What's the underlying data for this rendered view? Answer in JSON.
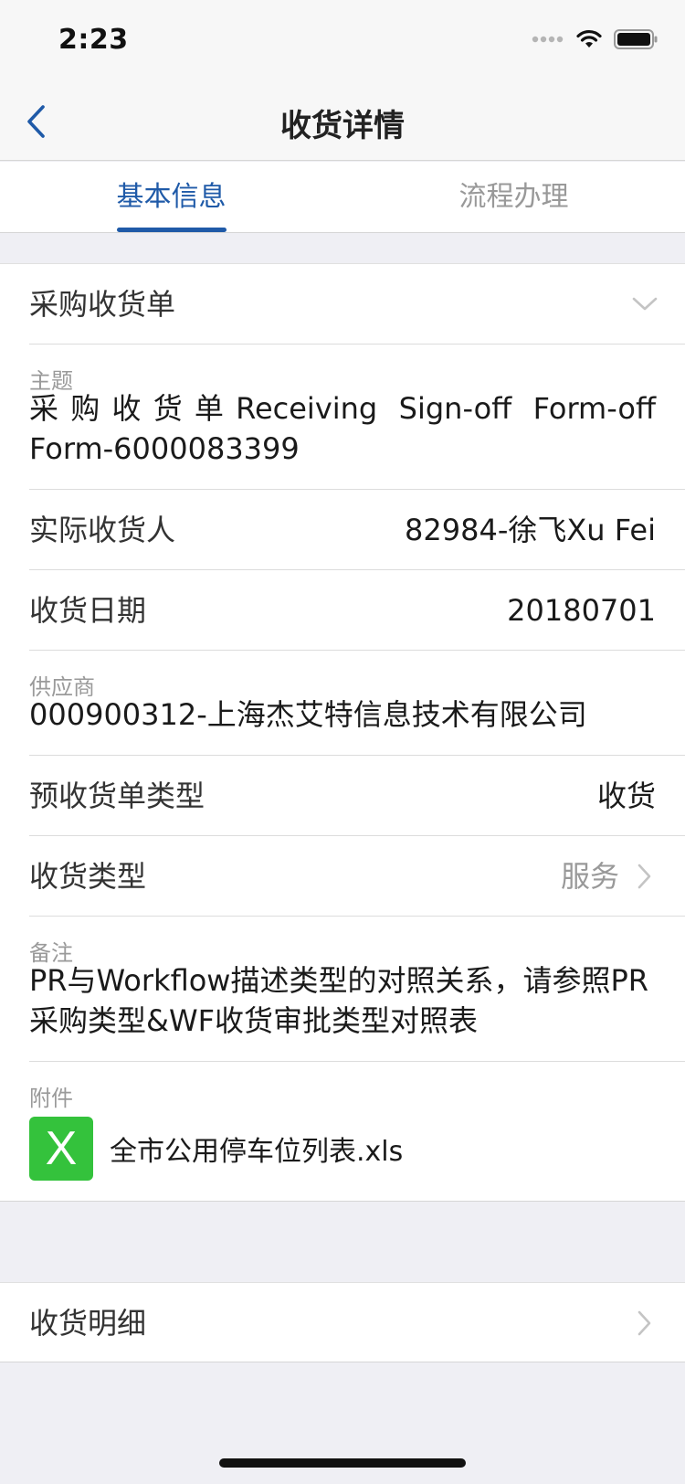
{
  "status_bar": {
    "time": "2:23"
  },
  "nav": {
    "title": "收货详情",
    "back_icon": "chevron-left-icon"
  },
  "tabs": [
    {
      "label": "基本信息",
      "active": true
    },
    {
      "label": "流程办理",
      "active": false
    }
  ],
  "form": {
    "section_title": "采购收货单",
    "subject": {
      "label": "主题",
      "value": "采购收货单Receiving Sign-off Form-off Form-6000083399"
    },
    "receiver": {
      "label": "实际收货人",
      "value": "82984-徐飞Xu Fei"
    },
    "receive_date": {
      "label": "收货日期",
      "value": "20180701"
    },
    "supplier": {
      "label": "供应商",
      "value": "000900312-上海杰艾特信息技术有限公司"
    },
    "pre_receipt_type": {
      "label": "预收货单类型",
      "value": "收货"
    },
    "receipt_type": {
      "label": "收货类型",
      "value": "服务"
    },
    "remark": {
      "label": "备注",
      "value": "PR与Workflow描述类型的对照关系，请参照PR采购类型&WF收货审批类型对照表"
    },
    "attachment": {
      "label": "附件",
      "icon_text": "X",
      "file_name": "全市公用停车位列表.xls"
    }
  },
  "details": {
    "label": "收货明细"
  },
  "colors": {
    "accent": "#1f5aa8",
    "xls_green": "#34c23c",
    "background": "#efeff4"
  }
}
